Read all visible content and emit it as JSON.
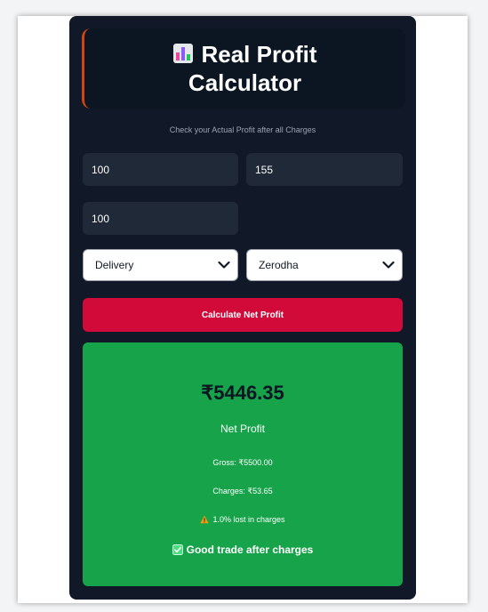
{
  "header": {
    "title": "Real Profit Calculator",
    "icon": "bar-chart-icon"
  },
  "subtitle": "Check your Actual Profit after all Charges",
  "inputs": {
    "buy_value": "100",
    "sell_value": "155",
    "quantity_value": "100"
  },
  "selects": {
    "trade_type": "Delivery",
    "broker": "Zerodha"
  },
  "button": {
    "calculate_label": "Calculate Net Profit"
  },
  "result": {
    "amount": "₹5446.35",
    "label": "Net Profit",
    "gross": "Gross: ₹5500.00",
    "charges": "Charges: ₹53.65",
    "lost": "1.0% lost in charges",
    "verdict": "Good trade after charges"
  },
  "colors": {
    "card_bg": "#111827",
    "header_bg": "#0b1622",
    "accent_border": "#d0450f",
    "input_bg": "#1f2937",
    "button_bg": "#d10a3a",
    "result_bg": "#16a34a"
  }
}
